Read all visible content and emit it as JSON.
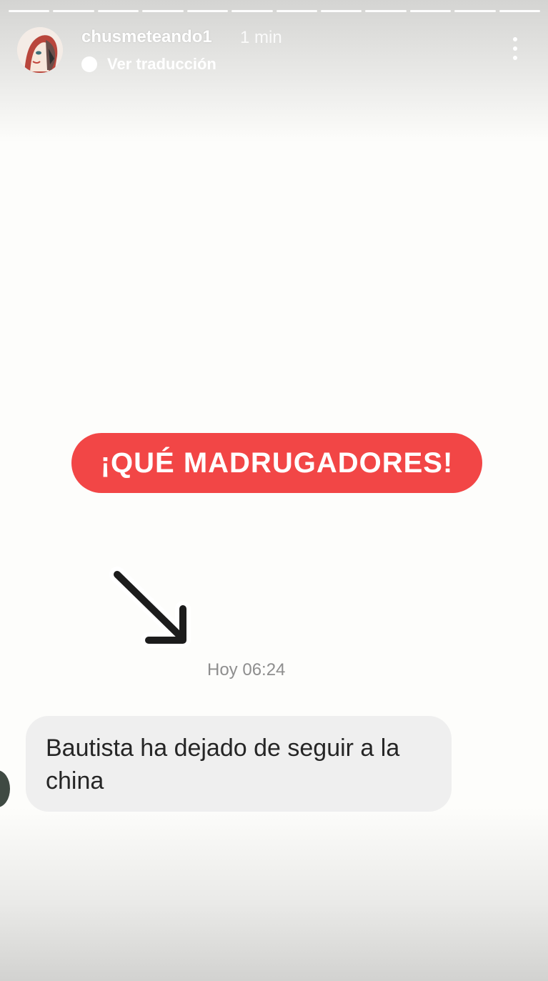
{
  "story": {
    "segment_count": 12,
    "username": "chusmeteando1",
    "time_ago": "1 min",
    "translate_label": "Ver traducción"
  },
  "sticker": {
    "text": "¡QUÉ MADRUGADORES!",
    "color": "#f24646"
  },
  "chat": {
    "timestamp": "Hoy 06:24",
    "message": "Bautista ha dejado de seguir a la china"
  },
  "icons": {
    "menu": "more-vertical-icon",
    "arrow": "arrow-down-right-icon",
    "translate": "translate-icon"
  }
}
